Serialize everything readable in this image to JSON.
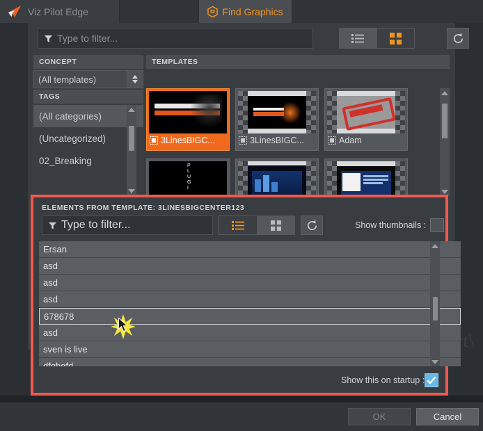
{
  "window": {
    "brand": "Viz Pilot Edge",
    "tabs": [
      {
        "label": "Viz Pilot Edge",
        "active": false,
        "icon": "arrow-logo-icon"
      },
      {
        "label": "",
        "active": false,
        "icon": ""
      },
      {
        "label": "Find Graphics",
        "active": true,
        "icon": "hexagon-graphics-icon"
      }
    ]
  },
  "toolbar": {
    "filter_placeholder": "Type to filter...",
    "filter_value": "",
    "list_view_icon": "list-view-icon",
    "grid_view_icon": "grid-view-icon",
    "refresh_icon": "refresh-icon",
    "active_view": "grid"
  },
  "sidebar": {
    "concept_header": "CONCEPT",
    "concept_selected": "(All templates)",
    "tags_header": "TAGS",
    "tags": [
      {
        "label": "(All categories)",
        "selected": true
      },
      {
        "label": "(Uncategorized)",
        "selected": false
      },
      {
        "label": "02_Breaking",
        "selected": false
      }
    ]
  },
  "templates": {
    "header": "TEMPLATES",
    "items": [
      {
        "label": "3LinesBIGC...",
        "selected": true,
        "thumb": "3lines-orange-thumb"
      },
      {
        "label": "3LinesBIGC...",
        "selected": false,
        "thumb": "3lines-splash-thumb"
      },
      {
        "label": "Adam",
        "selected": false,
        "thumb": "busted-stamp-thumb"
      },
      {
        "label": "",
        "selected": false,
        "thumb": "plugin-text-thumb"
      },
      {
        "label": "",
        "selected": false,
        "thumb": "blue-world-thumb"
      },
      {
        "label": "",
        "selected": false,
        "thumb": "blue-slide-thumb"
      }
    ]
  },
  "background_text": "art\\",
  "dialog": {
    "title": "ELEMENTS FROM TEMPLATE: 3LINESBIGCENTER123",
    "filter_placeholder": "Type to filter...",
    "filter_value": "",
    "list_view_icon": "list-view-icon",
    "grid_view_icon": "grid-view-icon",
    "refresh_icon": "refresh-icon",
    "active_view": "list",
    "show_thumbnails_label": "Show thumbnails :",
    "show_thumbnails_checked": false,
    "show_startup_label": "Show this on startup :",
    "show_startup_checked": true,
    "border_color": "#f2584c",
    "rows": [
      {
        "label": "Ersan",
        "selected": false
      },
      {
        "label": "asd",
        "selected": false
      },
      {
        "label": "asd",
        "selected": false
      },
      {
        "label": "asd",
        "selected": false
      },
      {
        "label": "678678",
        "selected": true
      },
      {
        "label": "asd",
        "selected": false
      },
      {
        "label": "sven is live",
        "selected": false
      },
      {
        "label": "dfgbgfd",
        "selected": false
      }
    ]
  },
  "footer": {
    "ok_label": "OK",
    "cancel_label": "Cancel"
  },
  "colors": {
    "accent_orange": "#f0941f",
    "selection_orange": "#f06a1e",
    "dialog_red": "#f2584c",
    "checkbox_blue": "#69b9e7"
  }
}
